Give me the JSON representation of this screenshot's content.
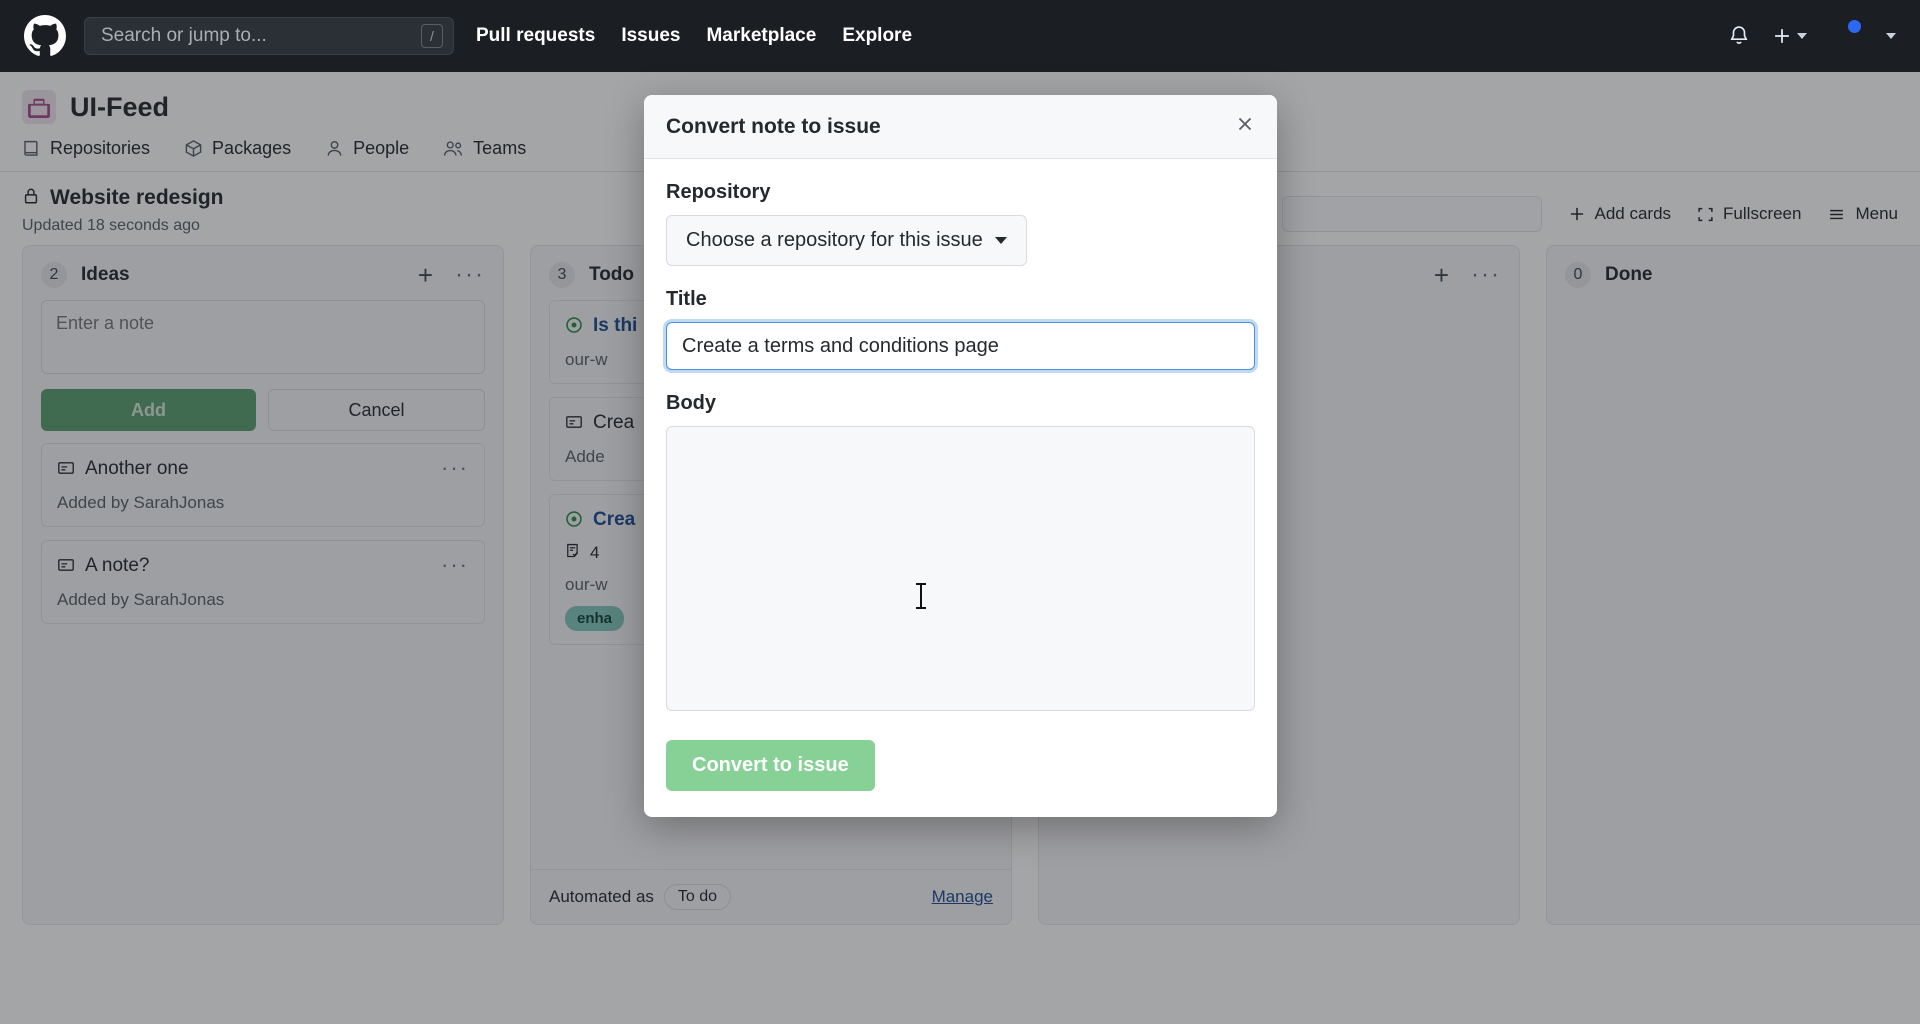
{
  "header": {
    "logo_icon": "github-mark-icon",
    "search": {
      "placeholder": "Search or jump to...",
      "shortcut": "/"
    },
    "nav": [
      {
        "label": "Pull requests"
      },
      {
        "label": "Issues"
      },
      {
        "label": "Marketplace"
      },
      {
        "label": "Explore"
      }
    ],
    "notifications_icon": "bell-icon",
    "create_icon": "plus-icon",
    "account_icon": "avatar"
  },
  "org": {
    "name": "UI-Feed",
    "avatar_icon": "organization-icon",
    "tabs": [
      {
        "label": "Repositories",
        "icon": "repo-icon"
      },
      {
        "label": "Packages",
        "icon": "package-icon"
      },
      {
        "label": "People",
        "icon": "person-icon"
      },
      {
        "label": "Teams",
        "icon": "people-icon"
      }
    ]
  },
  "project": {
    "lock_icon": "lock-icon",
    "name": "Website redesign",
    "updated": "Updated 18 seconds ago",
    "search_placeholder": "",
    "add_cards_label": "Add cards",
    "fullscreen_label": "Fullscreen",
    "menu_label": "Menu"
  },
  "board": {
    "columns": [
      {
        "count": "2",
        "title": "Ideas",
        "compose": {
          "placeholder": "Enter a note",
          "add_label": "Add",
          "cancel_label": "Cancel"
        },
        "cards": [
          {
            "type": "note",
            "icon": "note-icon",
            "title": "Another one",
            "meta": "Added by SarahJonas"
          },
          {
            "type": "note",
            "icon": "note-icon",
            "title": "A note?",
            "meta": "Added by SarahJonas"
          }
        ],
        "footer": null
      },
      {
        "count": "3",
        "title": "Todo",
        "compose": null,
        "cards": [
          {
            "type": "issue",
            "icon": "issue-open-icon",
            "title": "Is thi",
            "meta": "our-w"
          },
          {
            "type": "note",
            "icon": "note-icon",
            "title": "Crea",
            "meta": "Adde"
          },
          {
            "type": "issue",
            "icon": "issue-open-icon",
            "title": "Crea",
            "tasks": "4",
            "meta": "our-w",
            "label": "enha"
          }
        ],
        "footer": {
          "automated_prefix": "Automated as",
          "automated_value": "To do",
          "manage_label": "Manage"
        }
      },
      {
        "count": "",
        "title": "",
        "compose": null,
        "cards": [],
        "footer": null
      },
      {
        "count": "0",
        "title": "Done",
        "compose": null,
        "cards": [],
        "footer": null
      }
    ]
  },
  "modal": {
    "title": "Convert note to issue",
    "close_icon": "close-icon",
    "repository_label": "Repository",
    "repository_value": "Choose a repository for this issue",
    "title_label": "Title",
    "title_value": "Create a terms and conditions page",
    "body_label": "Body",
    "body_value": "",
    "submit_label": "Convert to issue"
  },
  "colors": {
    "header_bg": "#1b1f23",
    "accent_link": "#1c4b8f",
    "submit_green": "#87d096",
    "add_green": "#5a9e6f",
    "focus_blue": "#4a90e2",
    "label_chip": "#83c7bb"
  }
}
